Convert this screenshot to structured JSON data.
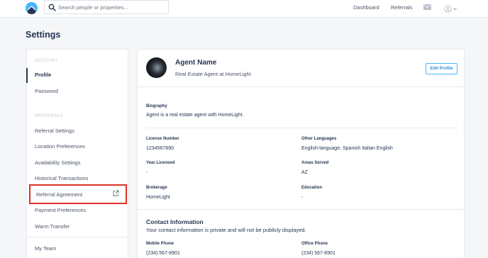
{
  "header": {
    "search": {
      "placeholder": "Search people or properties..."
    },
    "nav": {
      "dashboard": "Dashboard",
      "referrals": "Referrals"
    },
    "icons": {
      "logo": "homelight-logo",
      "search": "search-icon",
      "mail": "mail-icon",
      "user": "user-icon",
      "menu": "chevron-down-icon"
    }
  },
  "page": {
    "title": "Settings"
  },
  "sidebar": {
    "account_heading": "ACCOUNT",
    "account_items": [
      {
        "label": "Profile",
        "active": true
      },
      {
        "label": "Password"
      }
    ],
    "referrals_heading": "REFERRALS",
    "referrals_items": [
      {
        "label": "Referral Settings"
      },
      {
        "label": "Location Preferences"
      },
      {
        "label": "Availability Settings"
      },
      {
        "label": "Historical Transactions"
      },
      {
        "label": "Referral Agreement",
        "icon": "external-link-icon",
        "highlighted": true
      },
      {
        "label": "Payment Preferences"
      },
      {
        "label": "Warm Transfer"
      }
    ],
    "other_items": [
      {
        "label": "My Team"
      }
    ]
  },
  "profile": {
    "name": "Agent Name",
    "role": "Real Estate Agent at HomeLight",
    "edit_label": "Edit Profile",
    "biography_label": "Biography",
    "biography": "Agent is a real estate agent with HomeLight.",
    "fields": {
      "license_number": {
        "label": "License Number",
        "value": "1234567890"
      },
      "other_languages": {
        "label": "Other Languages",
        "value": "English-language, Spanish Italian English"
      },
      "year_licensed": {
        "label": "Year Licensed",
        "value": "-"
      },
      "areas_served": {
        "label": "Areas Served",
        "value": "AZ"
      },
      "brokerage": {
        "label": "Brokerage",
        "value": "HomeLight"
      },
      "education": {
        "label": "Education",
        "value": "-"
      }
    },
    "contact": {
      "title": "Contact Information",
      "subtitle": "Your contact information is private and will not be publicly displayed.",
      "mobile": {
        "label": "Mobile Phone",
        "value": "(234) 567-8901"
      },
      "office": {
        "label": "Office Phone",
        "value": "(234) 567-8901"
      }
    }
  },
  "colors": {
    "accent": "#46b6ff",
    "highlight": "#e0312a",
    "text": "#273653"
  }
}
